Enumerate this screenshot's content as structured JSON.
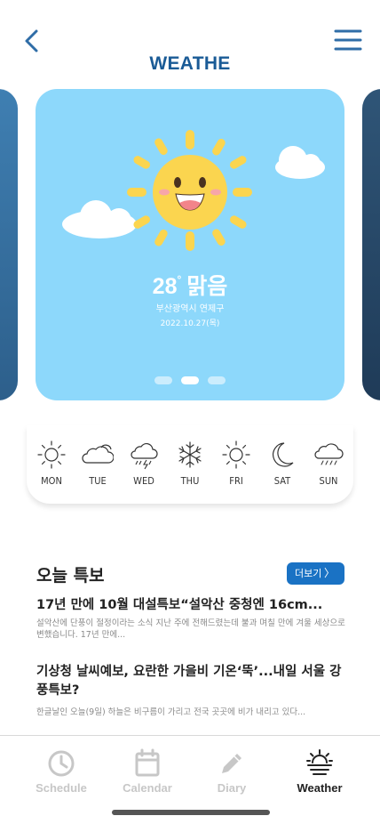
{
  "header": {
    "title": "WEATHE",
    "back_icon": "chevron-left-icon",
    "menu_icon": "hamburger-menu-icon",
    "accent_color": "#1a5b96"
  },
  "current_weather": {
    "temperature": "28",
    "degree_symbol": "°",
    "condition": "맑음",
    "location": "부산광역시 연제구",
    "date": "2022.10.27(목)",
    "icon": "smiling-sun-icon",
    "card_color": "#8dd8fb",
    "carousel": {
      "page_count": 3,
      "active_index": 1
    }
  },
  "forecast": [
    {
      "day": "MON",
      "icon": "sun-icon"
    },
    {
      "day": "TUE",
      "icon": "cloud-icon"
    },
    {
      "day": "WED",
      "icon": "thunderstorm-icon"
    },
    {
      "day": "THU",
      "icon": "snowflake-icon"
    },
    {
      "day": "FRI",
      "icon": "sun-icon"
    },
    {
      "day": "SAT",
      "icon": "moon-icon"
    },
    {
      "day": "SUN",
      "icon": "rain-cloud-icon"
    }
  ],
  "news": {
    "section_title": "오늘 특보",
    "more_label": "더보기",
    "more_chevron": "〉",
    "items": [
      {
        "headline": "17년 만에 10월 대설특보“설악산 중청엔 16cm...",
        "snippet": "설악산에 단풍이 절정이라는 소식 지난 주에 전해드렸는데 불과 며칠 만에 겨울 세상으로 변했습니다. 17년 만에..."
      },
      {
        "headline": "기상청 날씨예보, 요란한 가을비 기온‘뚝’...내일 서울 강풍특보?",
        "snippet": "한글날인 오늘(9일) 하늘은 비구름이 가리고 전국 곳곳에 비가 내리고 있다..."
      }
    ]
  },
  "tabbar": {
    "tabs": [
      {
        "label": "Schedule",
        "icon": "clock-icon",
        "active": false
      },
      {
        "label": "Calendar",
        "icon": "calendar-icon",
        "active": false
      },
      {
        "label": "Diary",
        "icon": "pencil-icon",
        "active": false
      },
      {
        "label": "Weather",
        "icon": "sunset-icon",
        "active": true
      }
    ]
  }
}
